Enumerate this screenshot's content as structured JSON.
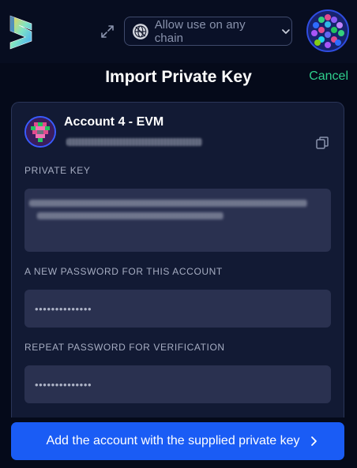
{
  "topbar": {
    "chain_selector_label": "Allow use on any chain"
  },
  "header": {
    "title": "Import Private Key",
    "cancel_label": "Cancel"
  },
  "account": {
    "name": "Account 4 - EVM"
  },
  "form": {
    "private_key_label": "PRIVATE KEY",
    "new_password_label": "A NEW PASSWORD FOR THIS ACCOUNT",
    "new_password_value": "••••••••••••••",
    "repeat_password_label": "REPEAT PASSWORD FOR VERIFICATION",
    "repeat_password_value": "••••••••••••••"
  },
  "submit": {
    "label": "Add the account with the supplied private key"
  },
  "colors": {
    "background": "#050a1a",
    "card": "#121a34",
    "input": "#2a3150",
    "accent_green": "#2fcf8d",
    "primary_button": "#1a5cf5"
  },
  "icons": [
    "subwallet-logo-icon",
    "expand-icon",
    "globe-icon",
    "chevron-down-icon",
    "copy-icon",
    "chevron-right-icon"
  ]
}
